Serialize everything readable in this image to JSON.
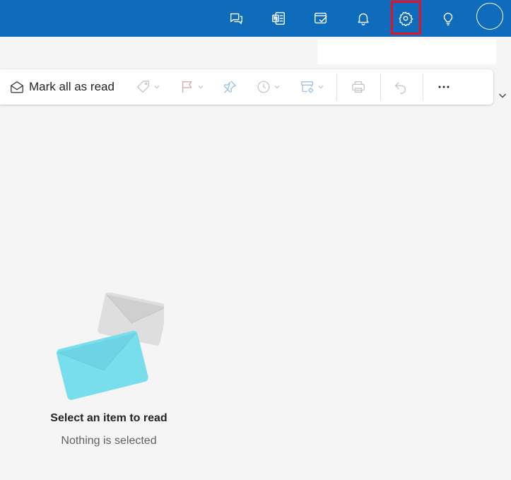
{
  "topbar": {
    "brand_color": "#0f6cbd",
    "icons": [
      "chat-icon",
      "onenote-icon",
      "todo-icon",
      "bell-icon",
      "gear-icon",
      "lightbulb-icon",
      "avatar"
    ],
    "highlighted": "gear-icon",
    "highlight_color": "#e81123"
  },
  "toolbar": {
    "mark_all_read_label": "Mark all as read",
    "buttons": [
      "envelope-open-icon",
      "tag-icon",
      "flag-icon",
      "pin-icon",
      "clock-icon",
      "rules-icon",
      "print-icon",
      "undo-icon",
      "more-icon"
    ],
    "disabled_color": "#c8c8c8",
    "flag_color": "#e4a6a6"
  },
  "reading_pane": {
    "empty_title": "Select an item to read",
    "empty_subtitle": "Nothing is selected",
    "envelope_colors": [
      "#78deec",
      "#dedede"
    ]
  }
}
